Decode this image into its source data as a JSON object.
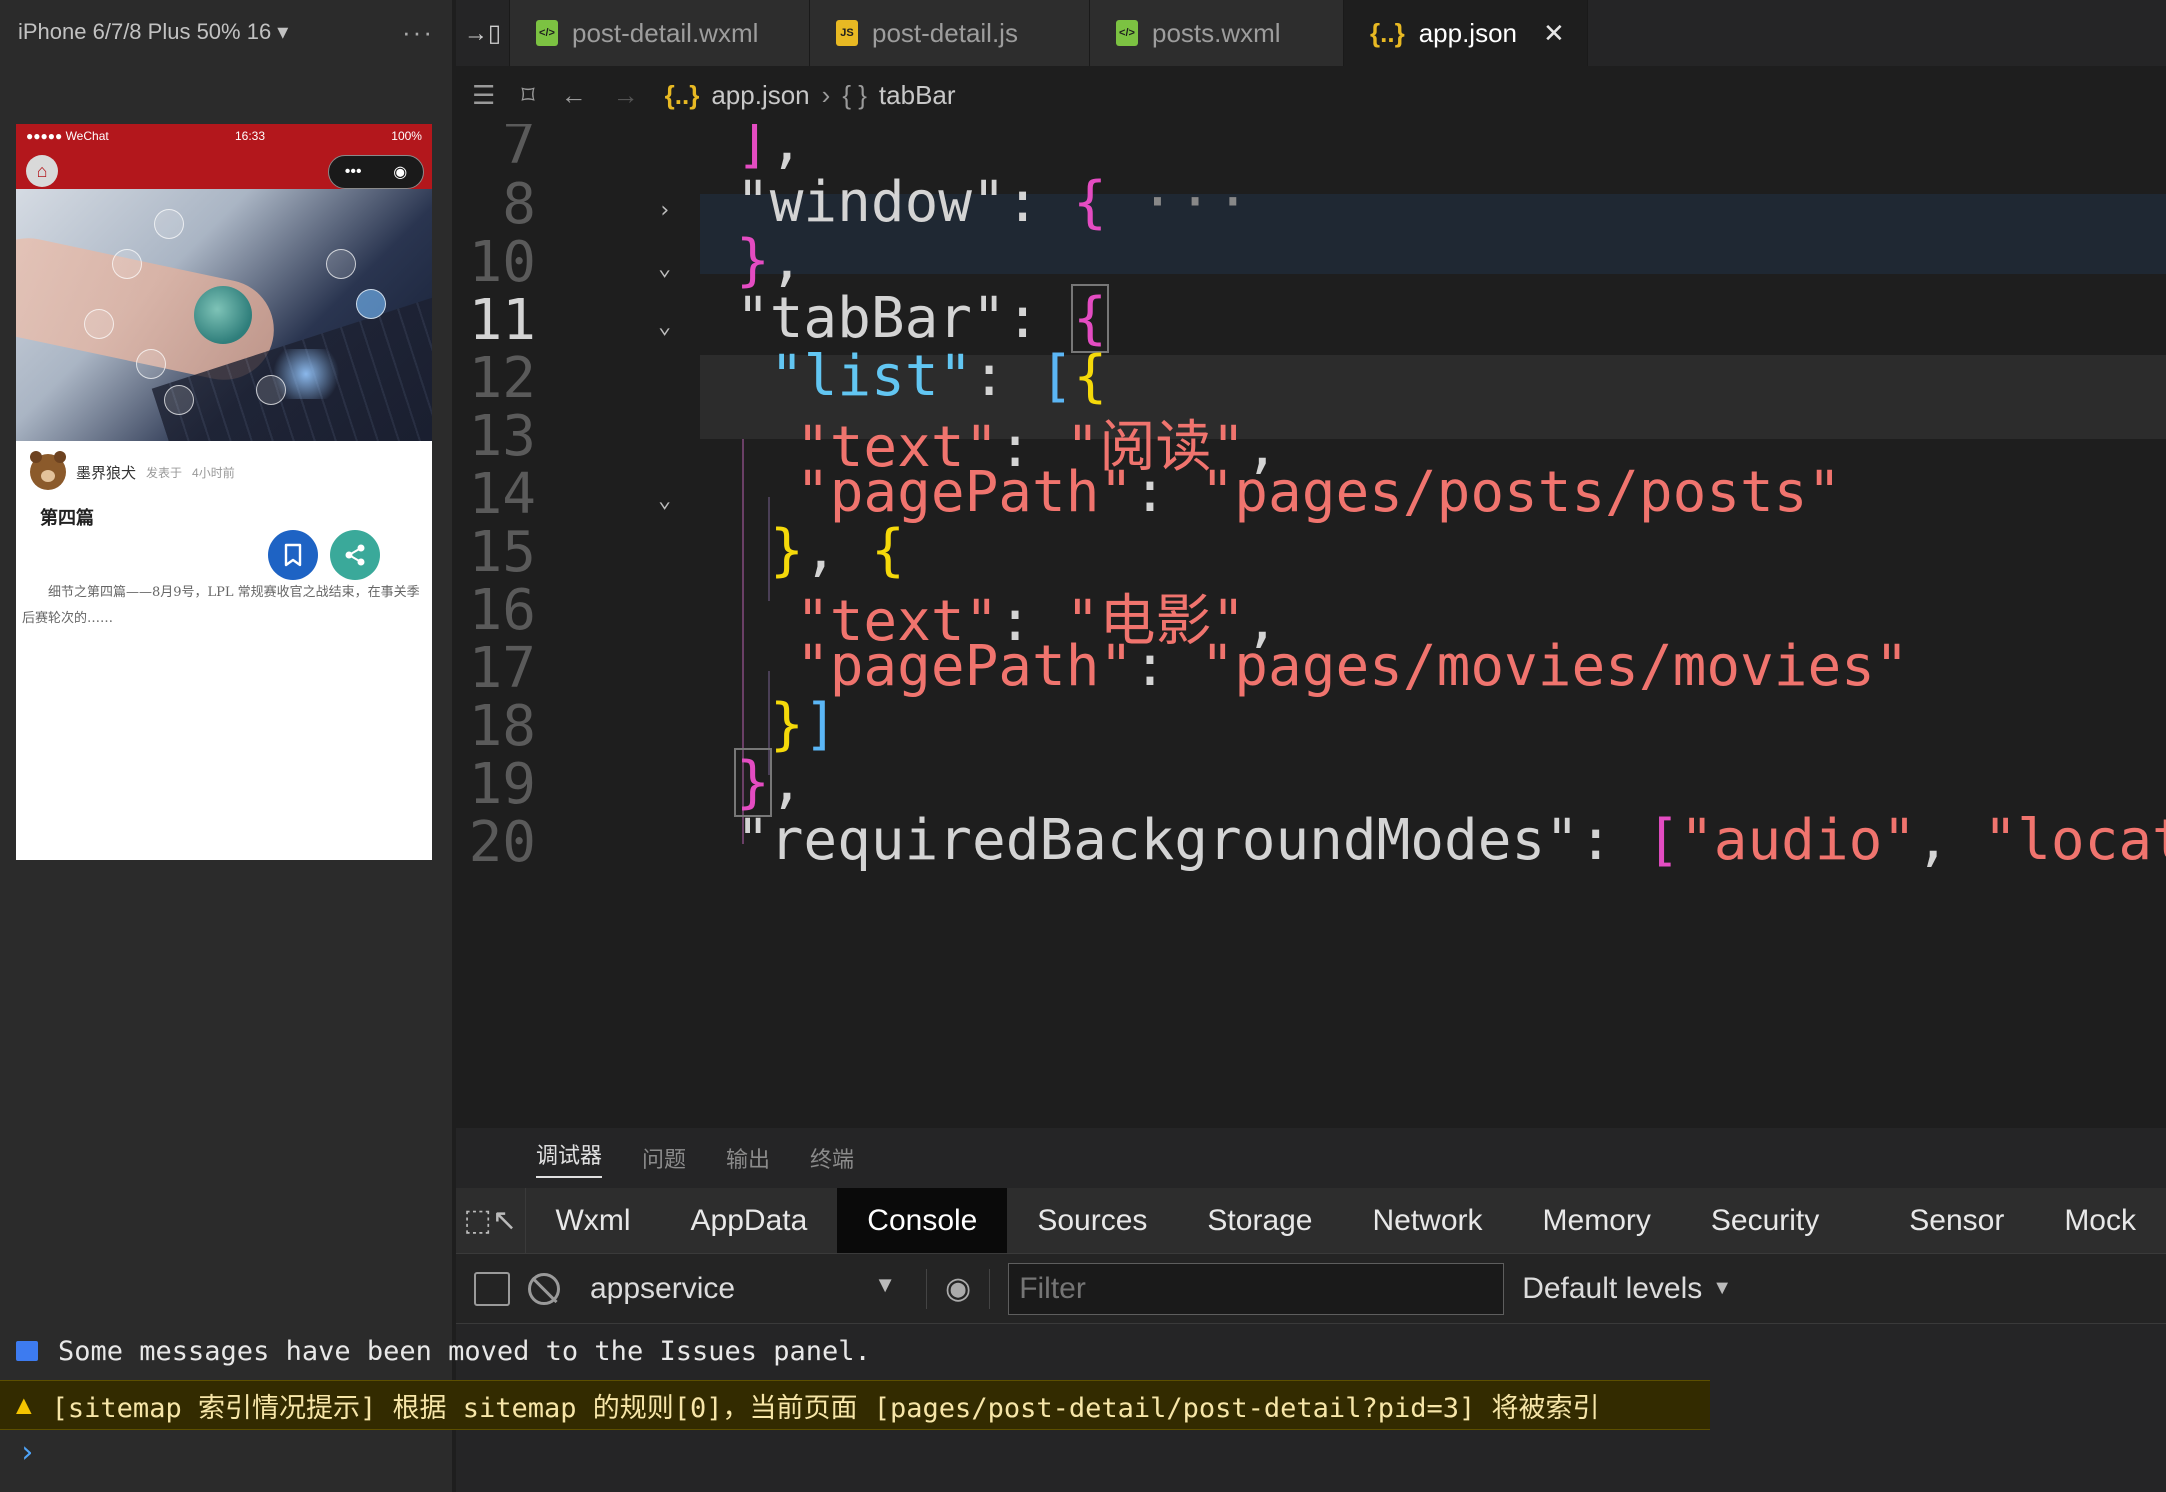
{
  "simulator": {
    "device_label": "iPhone 6/7/8 Plus 50% 16 ▾",
    "more": "···",
    "status": {
      "carrier": "●●●●● WeChat",
      "time": "16:33",
      "battery": "100%"
    },
    "post": {
      "author": "墨界狼犬",
      "posted_prefix": "发表于",
      "posted_time": "4小时前",
      "title": "第四篇",
      "body": "细节之第四篇——8月9号，LPL 常规赛收官之战结束，在事关季后赛轮次的……"
    }
  },
  "tabs": [
    {
      "label": "post-detail.wxml",
      "icon": "wxml-file-icon"
    },
    {
      "label": "post-detail.js",
      "icon": "js-file-icon"
    },
    {
      "label": "posts.wxml",
      "icon": "wxml-file-icon"
    },
    {
      "label": "app.json",
      "icon": "json-file-icon",
      "active": true
    }
  ],
  "breadcrumb": {
    "file": "app.json",
    "symbol": "tabBar"
  },
  "editor": {
    "line_numbers": [
      "7",
      "8",
      "10",
      "11",
      "12",
      "13",
      "14",
      "15",
      "16",
      "17",
      "18",
      "19",
      "20"
    ],
    "current_line": "11",
    "lines": {
      "l7": {
        "close": "]",
        "comma": ","
      },
      "l8": {
        "key": "\"window\"",
        "colon": ": ",
        "brace": "{",
        "ellipsis": "···"
      },
      "l10": {
        "brace": "}",
        "comma": ","
      },
      "l11": {
        "key": "\"tabBar\"",
        "colon": ": ",
        "brace": "{"
      },
      "l12": {
        "key": "\"list\"",
        "colon": ": ",
        "bracket": "[",
        "brace": "{"
      },
      "l13": {
        "key": "\"text\"",
        "colon": ": ",
        "value": "\"阅读\"",
        "comma": ","
      },
      "l14": {
        "key": "\"pagePath\"",
        "colon": ": ",
        "value": "\"pages/posts/posts\""
      },
      "l15": {
        "close": "}",
        "sep": ", ",
        "open": "{"
      },
      "l16": {
        "key": "\"text\"",
        "colon": ": ",
        "value": "\"电影\"",
        "comma": ","
      },
      "l17": {
        "key": "\"pagePath\"",
        "colon": ": ",
        "value": "\"pages/movies/movies\""
      },
      "l18": {
        "brace": "}",
        "bracket": "]"
      },
      "l19": {
        "brace": "}",
        "comma": ","
      },
      "l20": {
        "key": "\"requiredBackgroundModes\"",
        "colon": ": ",
        "bracket": "[",
        "v1": "\"audio\"",
        "sep": ", ",
        "v2": "\"location\"",
        "close": "]"
      }
    }
  },
  "debugger": {
    "panel_tabs": [
      "调试器",
      "问题",
      "输出",
      "终端"
    ],
    "devtools_tabs": [
      "Wxml",
      "AppData",
      "Console",
      "Sources",
      "Storage",
      "Network",
      "Memory",
      "Security",
      "Sensor",
      "Mock"
    ],
    "active_devtools_tab": "Console",
    "context": "appservice",
    "filter_placeholder": "Filter",
    "levels": "Default levels",
    "messages": {
      "info": "Some messages have been moved to the Issues panel.",
      "warning": "[sitemap 索引情况提示] 根据 sitemap 的规则[0]，当前页面 [pages/post-detail/post-detail?pid=3] 将被索引"
    },
    "prompt": "›"
  },
  "colors": {
    "wechat_red": "#b3171c",
    "json_key": "#62c6f2",
    "json_string": "#f0746e",
    "bracket_magenta": "#e44cc2",
    "bracket_yellow": "#f5d90a",
    "bookmark_blue": "#1e63c4",
    "share_teal": "#3aa99a",
    "warning_bg": "#332b00"
  }
}
